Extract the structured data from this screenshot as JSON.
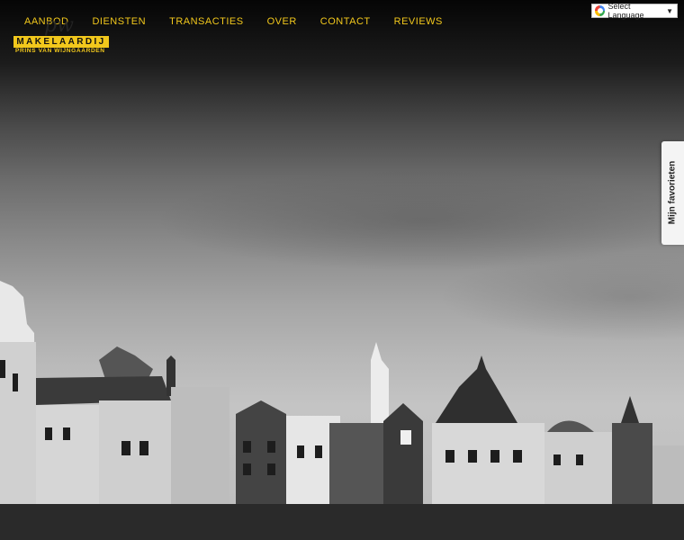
{
  "nav": {
    "items": [
      {
        "label": "AANBOD"
      },
      {
        "label": "DIENSTEN"
      },
      {
        "label": "TRANSACTIES"
      },
      {
        "label": "OVER"
      },
      {
        "label": "CONTACT"
      },
      {
        "label": "REVIEWS"
      }
    ]
  },
  "logo": {
    "script_text": "pw",
    "main": "MAKELAARDIJ",
    "sub": "PRINS VAN WIJNGAARDEN"
  },
  "language": {
    "label": "Select Language",
    "arrow": "▼",
    "icon": "google-icon"
  },
  "favorites": {
    "label": "Mijn favorieten"
  },
  "colors": {
    "accent": "#f2c81c"
  }
}
